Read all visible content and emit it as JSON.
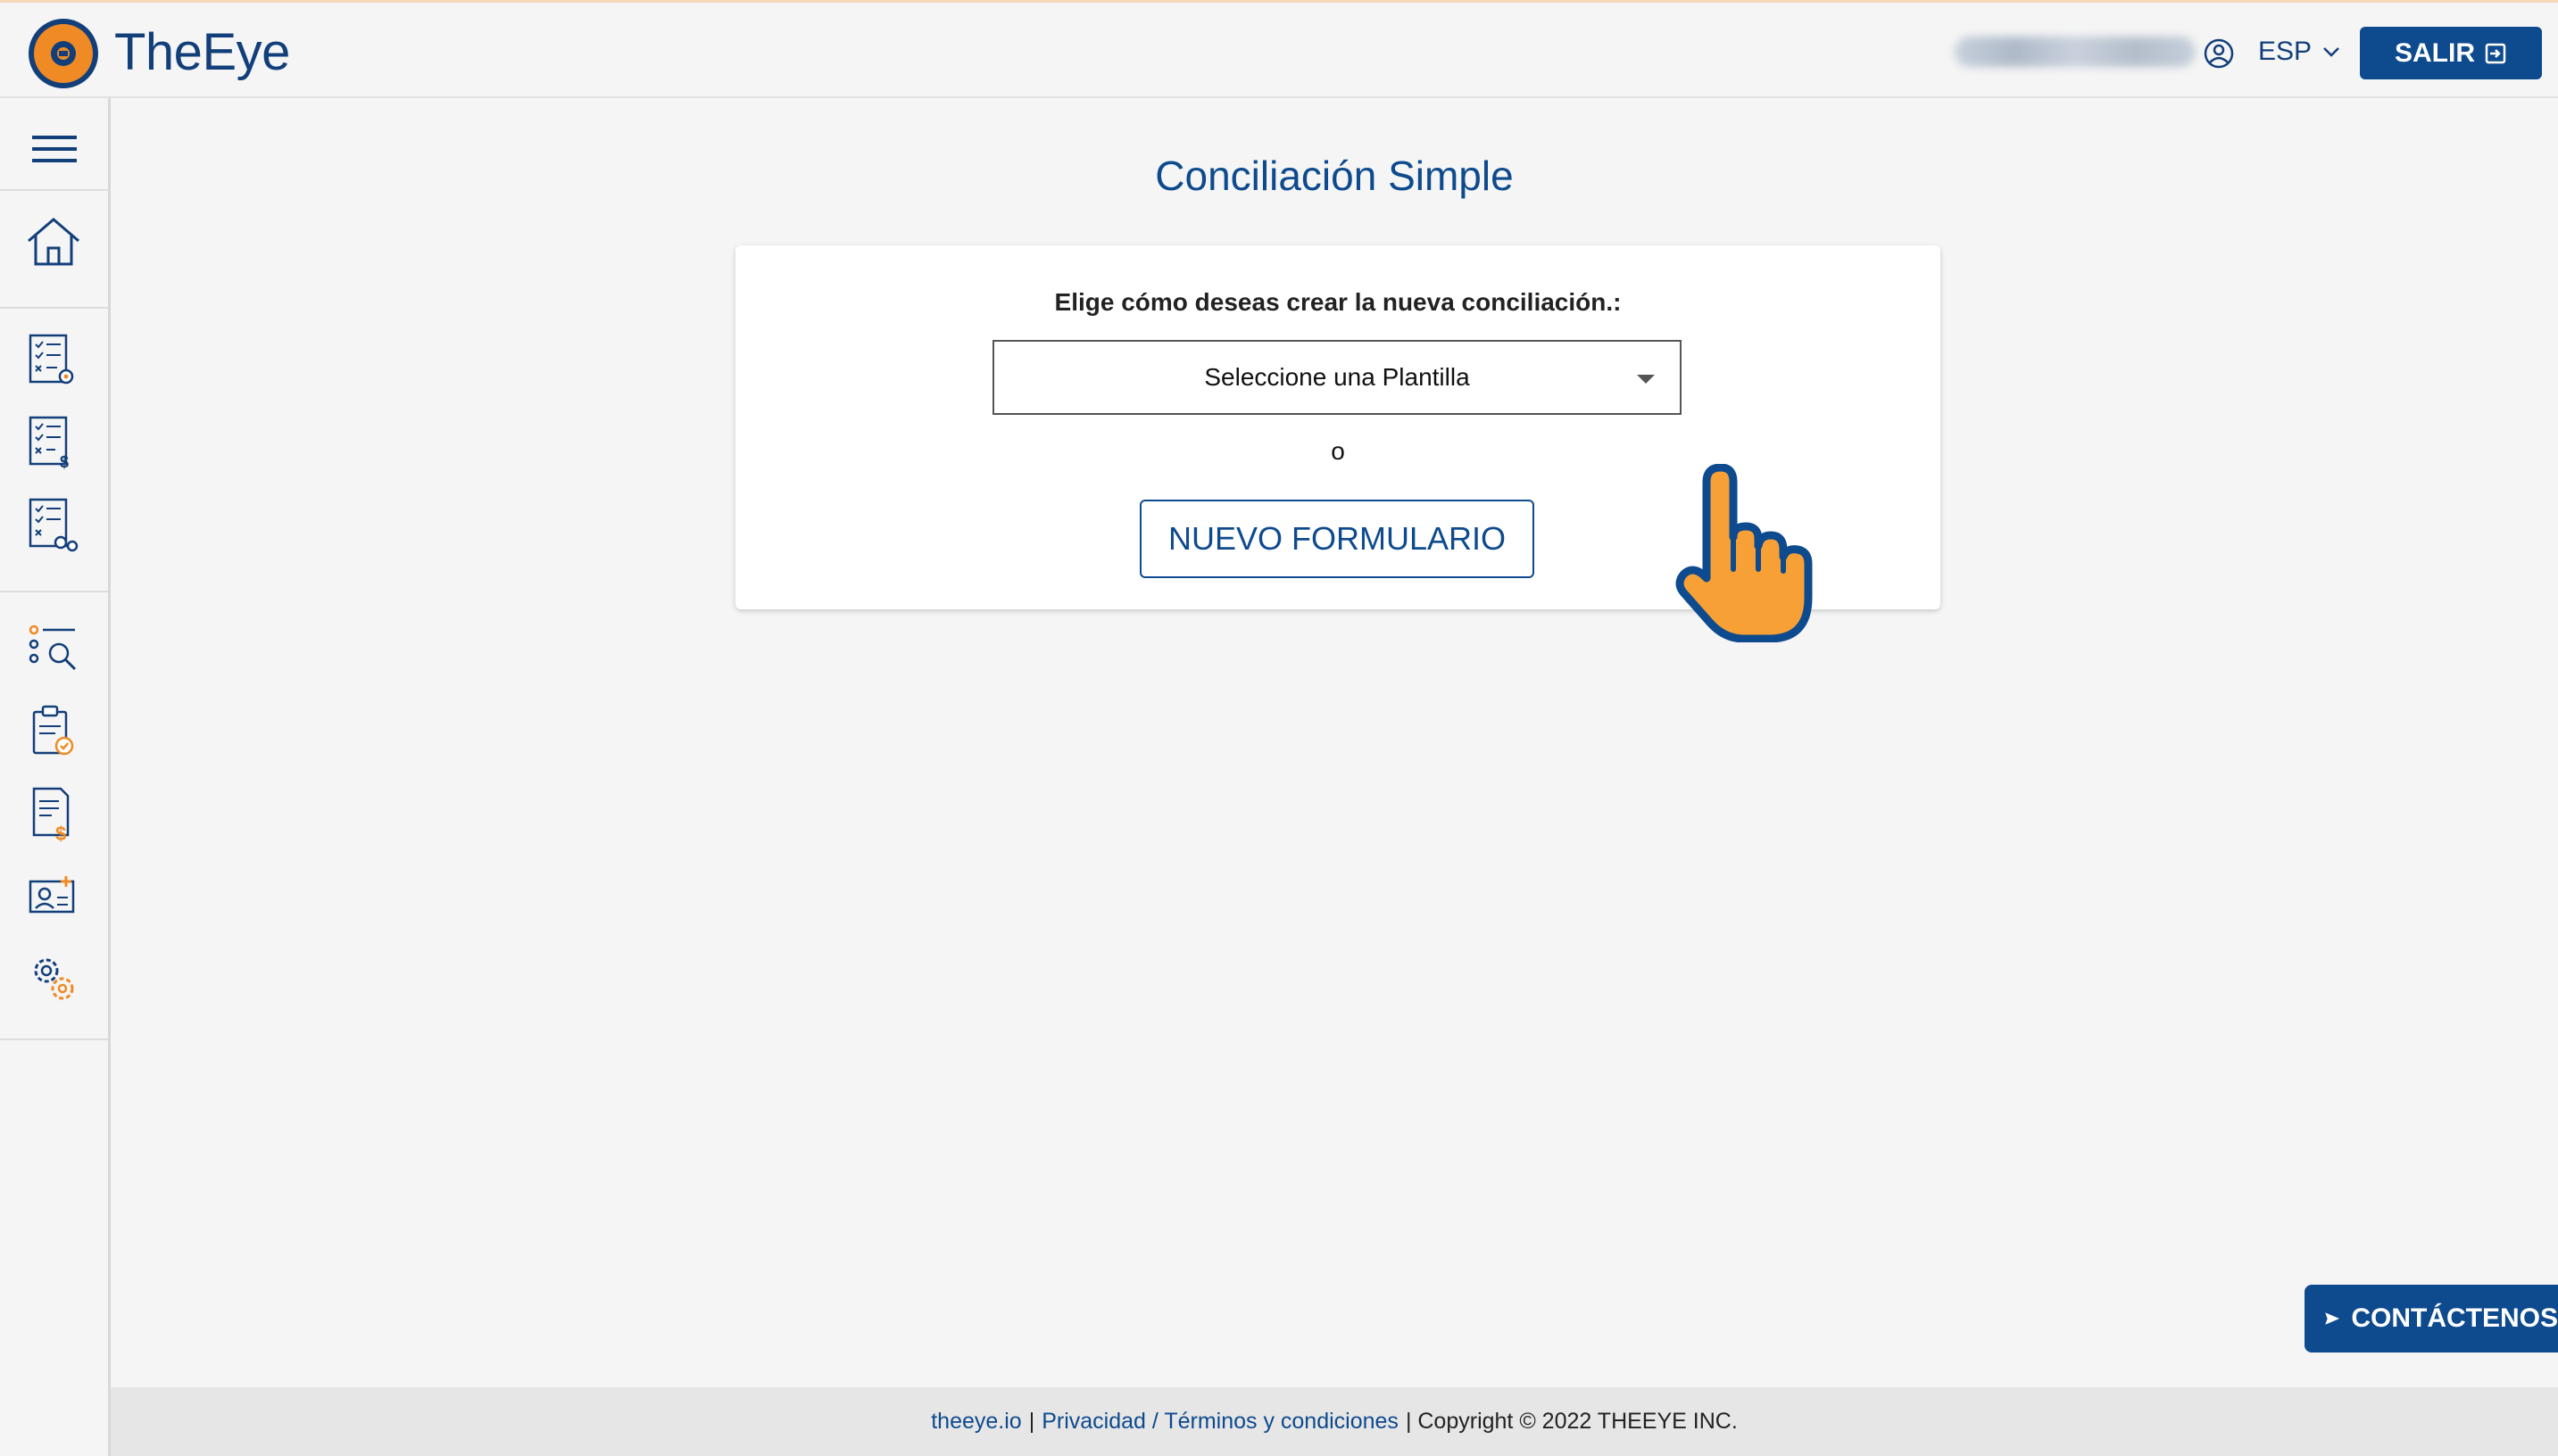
{
  "app": {
    "name": "TheEye"
  },
  "header": {
    "language": "ESP",
    "logout_label": "SALIR"
  },
  "sidebar": {
    "items": [
      {
        "icon": "menu-icon"
      },
      {
        "icon": "home-icon"
      },
      {
        "icon": "checklist-settings-icon"
      },
      {
        "icon": "checklist-dollar-icon"
      },
      {
        "icon": "checklist-gears-icon"
      },
      {
        "icon": "list-search-icon"
      },
      {
        "icon": "clipboard-check-icon"
      },
      {
        "icon": "document-dollar-icon"
      },
      {
        "icon": "contact-add-icon"
      },
      {
        "icon": "gears-icon"
      }
    ]
  },
  "main": {
    "title": "Conciliación Simple",
    "card": {
      "prompt": "Elige cómo deseas crear la nueva conciliación.:",
      "template_select": {
        "value": "Seleccione una Plantilla"
      },
      "or_text": "o",
      "new_form_label": "NUEVO FORMULARIO"
    }
  },
  "contact_button": {
    "label": "CONTÁCTENOS"
  },
  "footer": {
    "link_site": "theeye.io",
    "sep1": "|",
    "link_privacy": "Privacidad / Términos y condiciones",
    "copyright": "| Copyright © 2022 THEEYE INC."
  },
  "colors": {
    "primary": "#0e4a8e",
    "accent": "#f08a24",
    "background": "#f5f5f5"
  }
}
